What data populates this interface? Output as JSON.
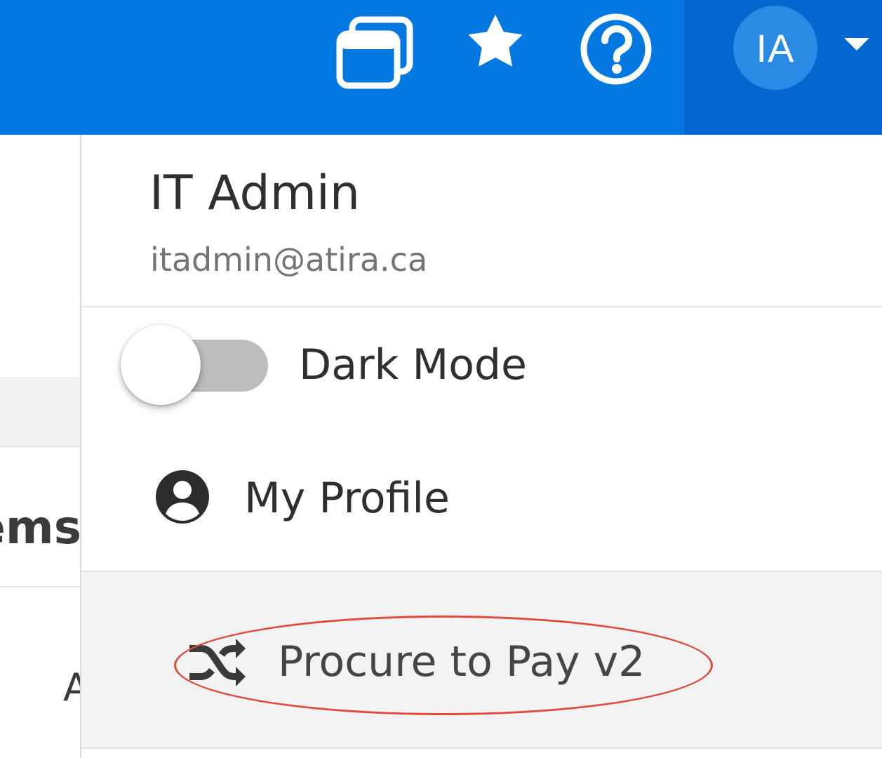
{
  "topbar": {
    "icons": {
      "windows": "windows-icon",
      "favorites": "star-icon",
      "help": "help-icon"
    },
    "avatar_initials": "IA",
    "caret": "caret-down-icon",
    "colors": {
      "bar": "#0278e0",
      "user_area": "#0268cf",
      "avatar_bg": "#2a8be5"
    }
  },
  "background": {
    "items_text": "ems",
    "partial_text": "A"
  },
  "dropdown": {
    "user_name": "IT Admin",
    "user_email": "itadmin@atira.ca",
    "dark_mode": {
      "label": "Dark Mode",
      "enabled": false
    },
    "profile": {
      "label": "My Profile",
      "icon": "user-circle-icon"
    },
    "switch_app": {
      "label": "Procure to Pay v2",
      "icon": "shuffle-icon",
      "highlighted": true
    }
  },
  "annotation": {
    "color": "#e04a3b"
  }
}
